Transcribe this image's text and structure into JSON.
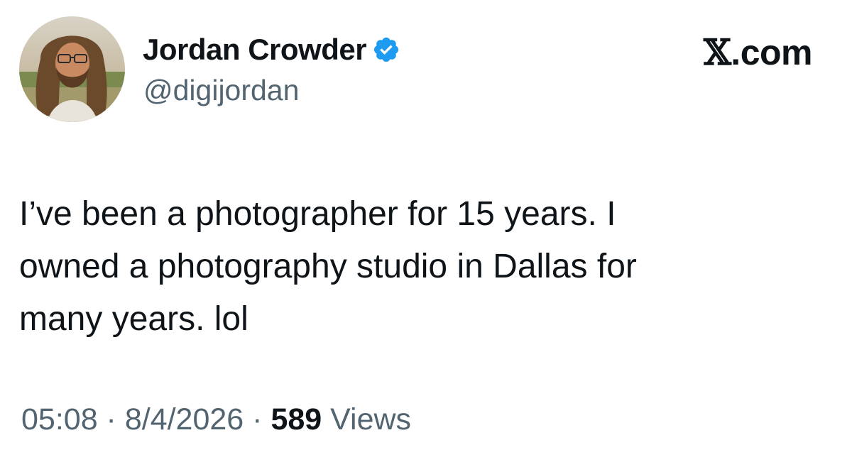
{
  "author": {
    "display_name": "Jordan Crowder",
    "handle": "@digijordan",
    "verified_icon": "verified-badge-icon",
    "verified_color": "#1d9bf0"
  },
  "site": {
    "logo_glyph": "𝕏",
    "logo_suffix": ".com"
  },
  "tweet": {
    "text": "I’ve been a photographer for 15 years. I\nowned a photography studio in Dallas for\nmany years. lol"
  },
  "meta": {
    "time": "05:08",
    "separator": " · ",
    "date": "8/4/2026",
    "views_count": "589",
    "views_label": " Views"
  },
  "colors": {
    "text": "#0f1419",
    "secondary": "#536471",
    "background": "#ffffff"
  }
}
